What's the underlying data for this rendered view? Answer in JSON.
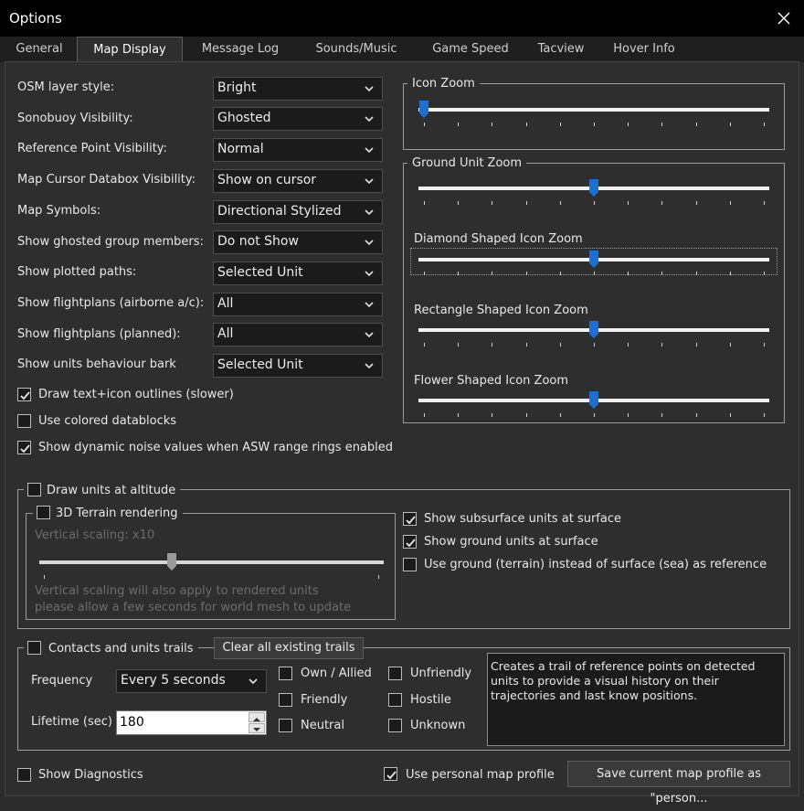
{
  "window": {
    "title": "Options"
  },
  "tabs": [
    "General",
    "Map Display",
    "Message Log",
    "Sounds/Music",
    "Game Speed",
    "Tacview",
    "Hover Info"
  ],
  "settings": [
    {
      "label": "OSM layer style:",
      "value": "Bright"
    },
    {
      "label": "Sonobuoy Visibility:",
      "value": "Ghosted"
    },
    {
      "label": "Reference Point Visibility:",
      "value": "Normal"
    },
    {
      "label": "Map Cursor Databox Visibility:",
      "value": "Show on cursor"
    },
    {
      "label": "Map Symbols:",
      "value": "Directional Stylized"
    },
    {
      "label": "Show ghosted group members:",
      "value": "Do not Show"
    },
    {
      "label": "Show plotted paths:",
      "value": "Selected Unit"
    },
    {
      "label": "Show flightplans (airborne a/c):",
      "value": "All"
    },
    {
      "label": "Show flightplans (planned):",
      "value": "All"
    },
    {
      "label": "Show units behaviour bark",
      "value": "Selected Unit"
    }
  ],
  "checks": [
    {
      "label": "Draw text+icon outlines (slower)",
      "checked": true
    },
    {
      "label": "Use colored datablocks",
      "checked": false
    },
    {
      "label": "Show dynamic noise values when ASW range rings enabled",
      "checked": true
    }
  ],
  "icon_zoom": {
    "title": "Icon Zoom",
    "value": 0.0
  },
  "ground_zoom": {
    "title": "Ground Unit Zoom",
    "ground_value": 0.5,
    "diamond_label": "Diamond Shaped Icon Zoom",
    "diamond_value": 0.5,
    "rect_label": "Rectangle Shaped Icon Zoom",
    "rect_value": 0.5,
    "flower_label": "Flower Shaped Icon Zoom",
    "flower_value": 0.5
  },
  "altitude": {
    "title": "Draw units at altitude",
    "terrain_title": "3D Terrain rendering",
    "scaling_label": "Vertical scaling: x10",
    "scaling_value": 0.38,
    "note1": "Vertical scaling will also apply to rendered units",
    "note2": "please allow a few seconds for world mesh to update",
    "opt_subsurface": "Show subsurface units at surface",
    "opt_ground": "Show ground units at surface",
    "opt_terrain": "Use ground (terrain) instead of surface (sea) as reference"
  },
  "trails": {
    "title": "Contacts and units trails",
    "clear_button": "Clear all existing trails",
    "frequency_label": "Frequency",
    "frequency_value": "Every 5 seconds",
    "lifetime_label": "Lifetime (sec)",
    "lifetime_value": "180",
    "own": "Own / Allied",
    "friendly": "Friendly",
    "neutral": "Neutral",
    "unfriendly": "Unfriendly",
    "hostile": "Hostile",
    "unknown": "Unknown",
    "description": "Creates a trail of reference points on detected units to provide a visual history on their trajectories and last know positions."
  },
  "footer": {
    "diagnostics": "Show Diagnostics",
    "personal_profile": "Use personal map profile",
    "save_profile": "Save current map profile as \"person..."
  },
  "colors": {
    "accent": "#1f6fd1",
    "background": "#2e2e2e",
    "titlebar": "#000000"
  }
}
